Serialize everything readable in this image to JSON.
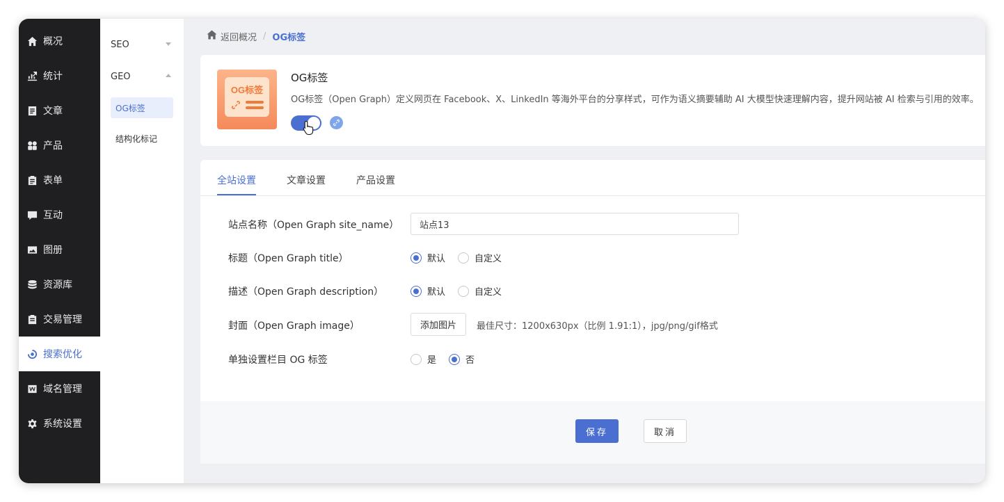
{
  "nav": {
    "items": [
      {
        "label": "概况",
        "icon": "home-icon"
      },
      {
        "label": "统计",
        "icon": "chart-icon"
      },
      {
        "label": "文章",
        "icon": "article-icon"
      },
      {
        "label": "产品",
        "icon": "grid-icon"
      },
      {
        "label": "表单",
        "icon": "clipboard-icon"
      },
      {
        "label": "互动",
        "icon": "chat-icon"
      },
      {
        "label": "图册",
        "icon": "image-icon"
      },
      {
        "label": "资源库",
        "icon": "database-icon"
      },
      {
        "label": "交易管理",
        "icon": "clipboard-icon"
      },
      {
        "label": "搜索优化",
        "icon": "search-optimize-icon",
        "active": true
      },
      {
        "label": "域名管理",
        "icon": "domain-icon"
      },
      {
        "label": "系统设置",
        "icon": "gear-icon"
      }
    ]
  },
  "subnav": {
    "seo": "SEO",
    "geo": "GEO",
    "items": [
      "OG标签",
      "结构化标记"
    ]
  },
  "breadcrumb": {
    "back": "返回概况",
    "sep": "/",
    "current": "OG标签"
  },
  "og_card": {
    "logo_text": "OG标签",
    "title": "OG标签",
    "description": "OG标签（Open Graph）定义网页在 Facebook、X、LinkedIn 等海外平台的分享样式，可作为语义摘要辅助 AI 大模型快速理解内容，提升网站被 AI 检索与引用的效率。",
    "enabled": true
  },
  "tabs": [
    "全站设置",
    "文章设置",
    "产品设置"
  ],
  "form": {
    "site_name_label": "站点名称（Open Graph site_name）",
    "site_name_value": "站点13",
    "title_label": "标题（Open Graph title）",
    "description_label": "描述（Open Graph description）",
    "image_label": "封面（Open Graph image）",
    "separate_label": "单独设置栏目 OG 标签",
    "opt_default": "默认",
    "opt_custom": "自定义",
    "opt_yes": "是",
    "opt_no": "否",
    "add_image": "添加图片",
    "image_hint": "最佳尺寸：1200x630px（比例 1.91:1），jpg/png/gif格式"
  },
  "actions": {
    "save": "保存",
    "cancel": "取消"
  },
  "colors": {
    "accent": "#4a6fd0",
    "nav_bg": "#1f1f21",
    "logo_orange": "#f07a3a"
  }
}
